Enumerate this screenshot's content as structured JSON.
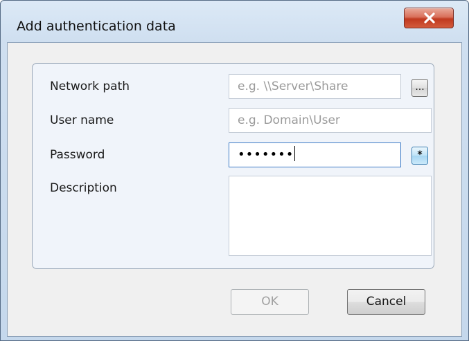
{
  "window": {
    "title": "Add authentication data",
    "close_symbol": "X"
  },
  "form": {
    "network_path": {
      "label": "Network path",
      "placeholder": "e.g. \\\\Server\\Share",
      "browse_label": "..."
    },
    "user_name": {
      "label": "User name",
      "placeholder": "e.g. Domain\\User"
    },
    "password": {
      "label": "Password",
      "masked_value": "•••••••",
      "toggle_label": "*"
    },
    "description": {
      "label": "Description",
      "value": ""
    }
  },
  "buttons": {
    "ok": "OK",
    "cancel": "Cancel"
  },
  "icons": {
    "close": "close-icon"
  }
}
